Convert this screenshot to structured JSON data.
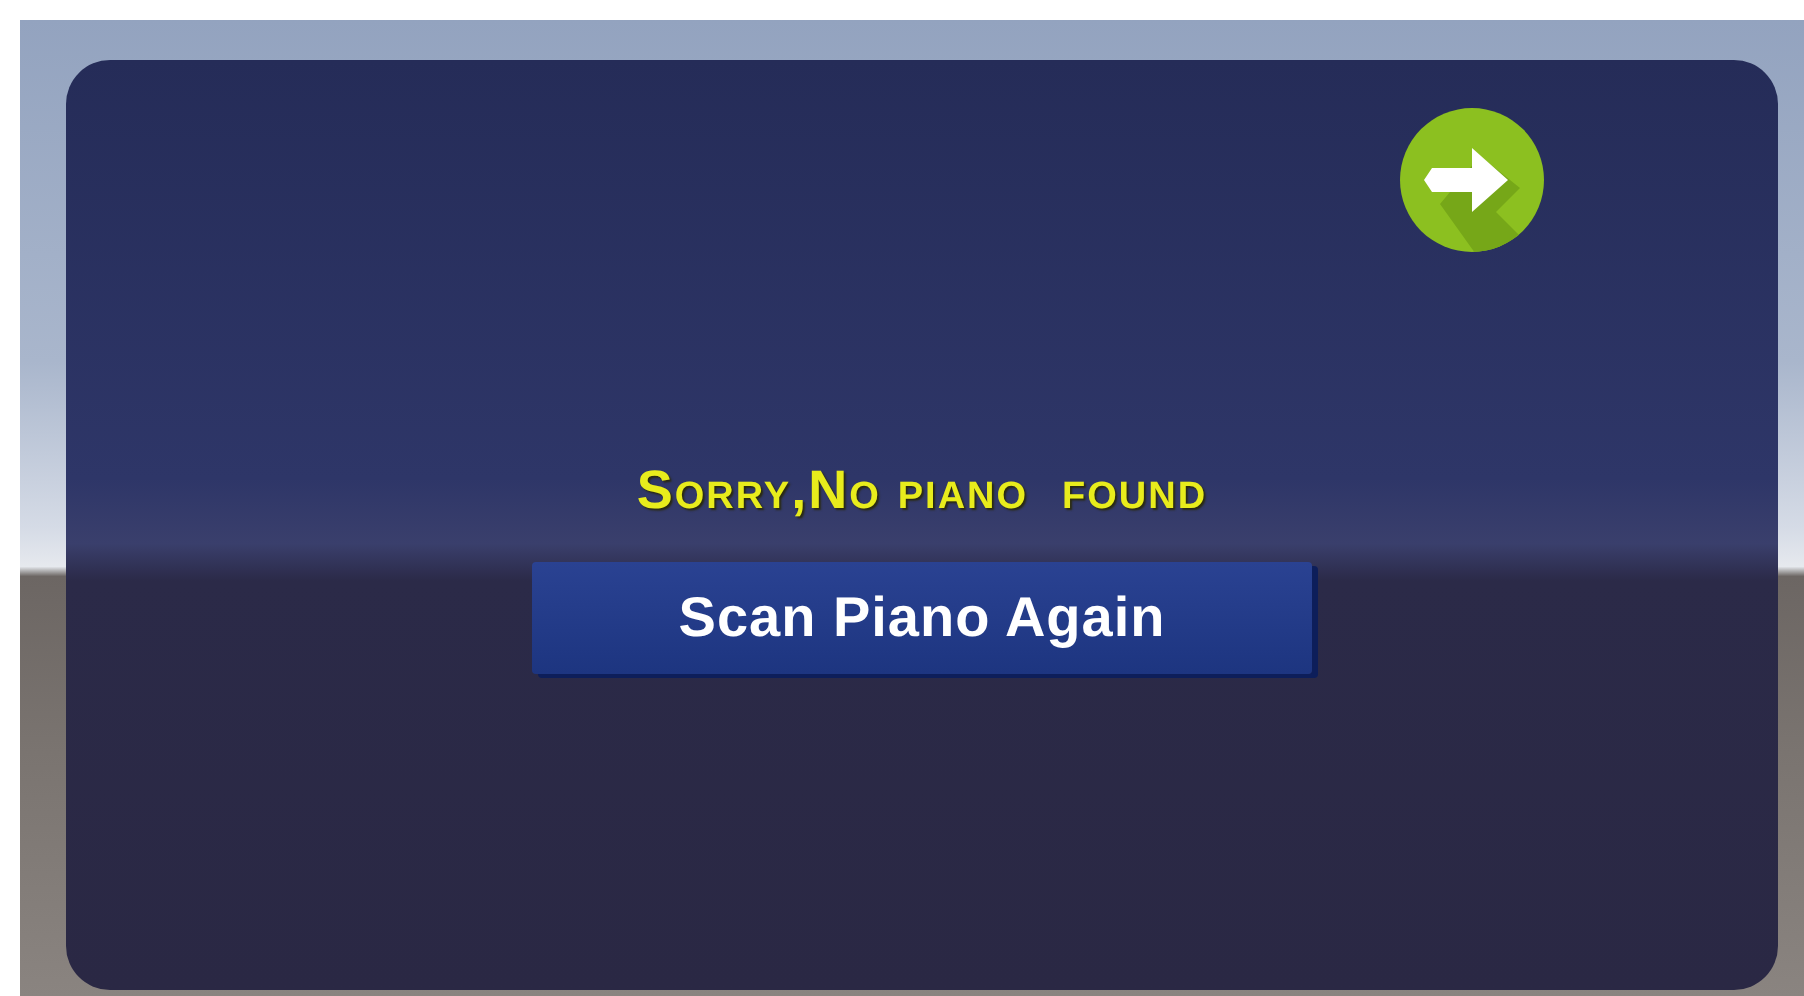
{
  "dialog": {
    "next_button": {
      "kind": "arrow"
    },
    "message": "Sorry,No piano  found",
    "scan_button": {
      "label": "Scan Piano Again"
    }
  }
}
